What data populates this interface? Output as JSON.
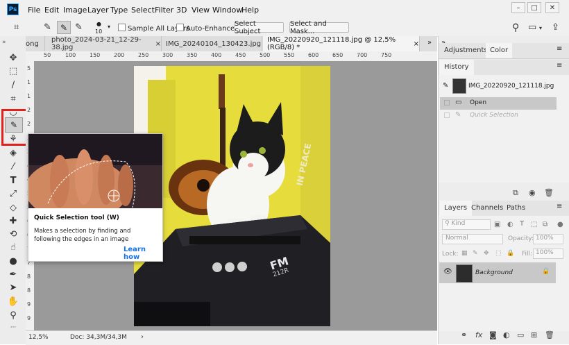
{
  "app": {
    "logo": "Ps"
  },
  "menu": [
    "File",
    "Edit",
    "Image",
    "Layer",
    "Type",
    "Select",
    "Filter",
    "3D",
    "View",
    "Window",
    "Help"
  ],
  "options": {
    "brush_size": "10",
    "sample_all_layers": "Sample All Layers",
    "auto_enhance": "Auto-Enhance",
    "select_subject": "Select Subject",
    "select_and_mask": "Select and Mask..."
  },
  "tabs": [
    {
      "label": "ong"
    },
    {
      "label": "photo_2024-03-21_12-29-38.jpg"
    },
    {
      "label": "IMG_20240104_130423.jpg"
    },
    {
      "label": "IMG_20220920_121118.jpg @ 12,5% (RGB/8) *"
    }
  ],
  "ruler": {
    "h_ticks": [
      "50",
      "100",
      "150",
      "200",
      "250",
      "300",
      "350",
      "400",
      "450",
      "500",
      "550",
      "600",
      "650",
      "700",
      "750"
    ],
    "v_ticks": [
      "5",
      "1",
      "1",
      "2",
      "2",
      "3",
      "3",
      "4",
      "4",
      "5",
      "5",
      "6",
      "6",
      "7",
      "7",
      "8",
      "8",
      "9",
      "9"
    ]
  },
  "image": {
    "amp_brand": "FM",
    "amp_model": "212R",
    "wall_text": "IN PEACE"
  },
  "tooltip": {
    "title": "Quick Selection tool (W)",
    "description": "Makes a selection by finding and following the edges in an image",
    "link": "Learn how"
  },
  "status": {
    "zoom": "12,5%",
    "doc": "Doc: 34,3M/34,3M",
    "arrow": "›"
  },
  "panels": {
    "top_tabs": [
      "Adjustments",
      "Color"
    ],
    "history": {
      "tab": "History",
      "snapshot": "IMG_20220920_121118.jpg",
      "states": [
        "Open",
        "Quick Selection"
      ]
    },
    "layers": {
      "tabs": [
        "Layers",
        "Channels",
        "Paths"
      ],
      "kind": "Kind",
      "blend": "Normal",
      "opacity_label": "Opacity:",
      "opacity": "100%",
      "lock_label": "Lock:",
      "fill_label": "Fill:",
      "fill": "100%",
      "layer_name": "Background"
    }
  },
  "colors": {
    "highlight": "#e0201a",
    "link": "#1473e6",
    "cat_wall": "#e6dd3c"
  }
}
